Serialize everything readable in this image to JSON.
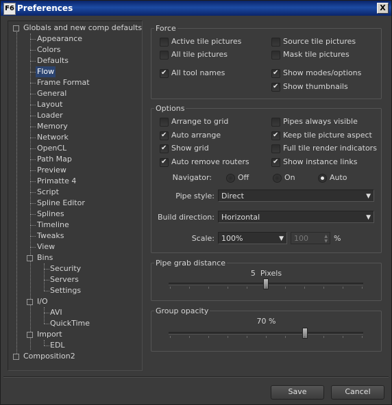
{
  "window": {
    "title": "Preferences",
    "app_icon": "F6",
    "close_label": "X"
  },
  "tree": {
    "root": "Globals and new comp defaults",
    "items": [
      "Appearance",
      "Colors",
      "Defaults",
      "Flow",
      "Frame Format",
      "General",
      "Layout",
      "Loader",
      "Memory",
      "Network",
      "OpenCL",
      "Path Map",
      "Preview",
      "Primatte 4",
      "Script",
      "Spline Editor",
      "Splines",
      "Timeline",
      "Tweaks",
      "View"
    ],
    "selected": "Flow",
    "bins": {
      "label": "Bins",
      "children": [
        "Security",
        "Servers",
        "Settings"
      ]
    },
    "io": {
      "label": "I/O",
      "children": [
        "AVI",
        "QuickTime"
      ]
    },
    "import": {
      "label": "Import",
      "children": [
        "EDL"
      ]
    },
    "comp2": "Composition2"
  },
  "force": {
    "legend": "Force",
    "options": [
      {
        "label": "Active tile pictures",
        "checked": false
      },
      {
        "label": "Source tile pictures",
        "checked": false
      },
      {
        "label": "All tile pictures",
        "checked": false
      },
      {
        "label": "Mask tile pictures",
        "checked": false
      },
      {
        "label": "All tool names",
        "checked": true
      },
      {
        "label": "Show modes/options",
        "checked": true
      },
      {
        "label": "Show thumbnails",
        "checked": true
      }
    ]
  },
  "options": {
    "legend": "Options",
    "checks": [
      {
        "label": "Arrange to grid",
        "checked": false
      },
      {
        "label": "Pipes always visible",
        "checked": false
      },
      {
        "label": "Auto arrange",
        "checked": true
      },
      {
        "label": "Keep tile picture aspect",
        "checked": true
      },
      {
        "label": "Show grid",
        "checked": true
      },
      {
        "label": "Full tile render indicators",
        "checked": false
      },
      {
        "label": "Auto remove routers",
        "checked": true
      },
      {
        "label": "Show instance links",
        "checked": true
      }
    ],
    "navigator_label": "Navigator:",
    "navigator": [
      "Off",
      "On",
      "Auto"
    ],
    "navigator_selected": "Auto",
    "pipe_style_label": "Pipe style:",
    "pipe_style": "Direct",
    "build_direction_label": "Build direction:",
    "build_direction": "Horizontal",
    "scale_label": "Scale:",
    "scale": "100%",
    "scale_value": "100",
    "scale_unit": "%"
  },
  "pipe_grab": {
    "legend": "Pipe grab distance",
    "value": "5",
    "unit": "Pixels",
    "level": 0.5
  },
  "group_opacity": {
    "legend": "Group opacity",
    "value": "70 %",
    "level": 0.7
  },
  "buttons": {
    "save": "Save",
    "cancel": "Cancel"
  },
  "icons": {
    "check": "check-icon",
    "dropdown": "chevron-down-icon",
    "spin": "spin-arrows-icon"
  }
}
